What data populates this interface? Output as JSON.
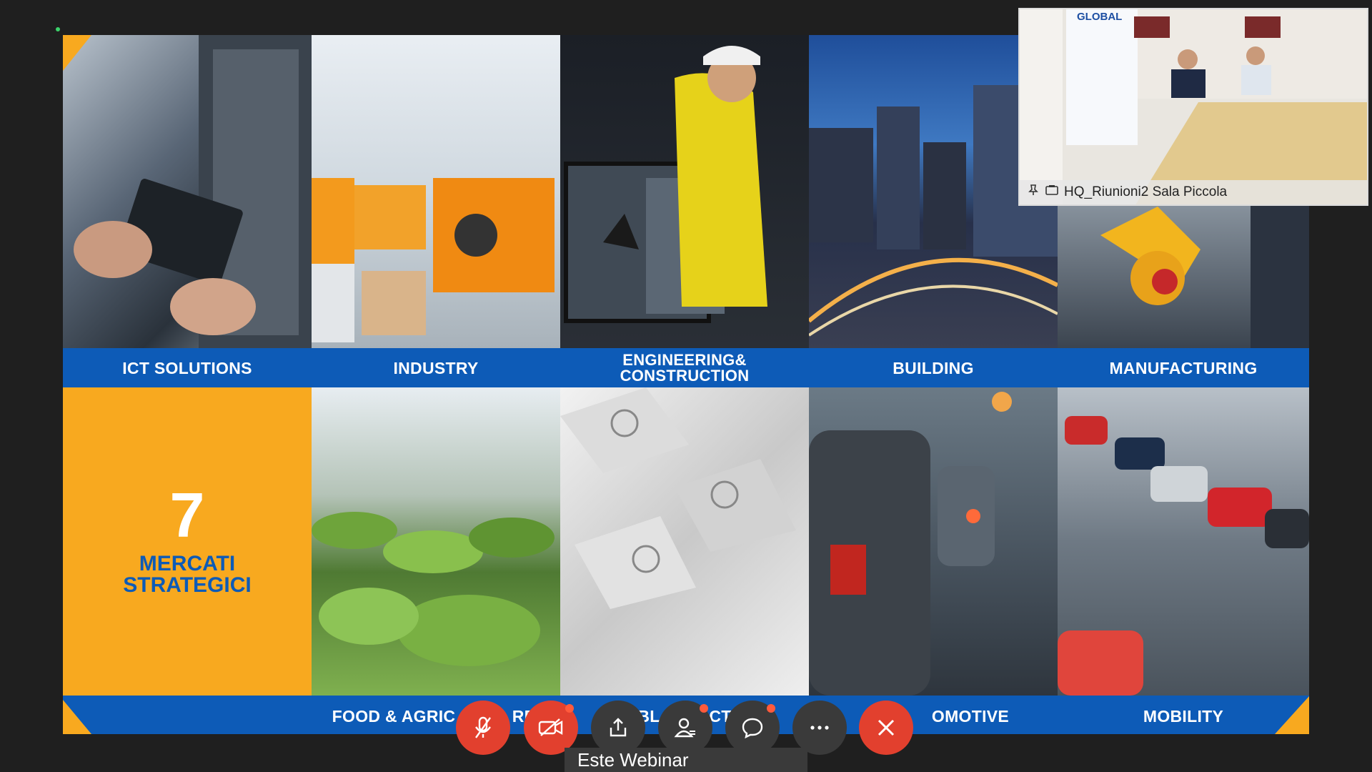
{
  "meeting": {
    "thumbnail_label": "HQ_Riunioni2 Sala Piccola",
    "thumbnail_banner_text": "GLOBAL",
    "webinar_title": "Este Webinar"
  },
  "slide": {
    "top_labels": [
      "ICT SOLUTIONS",
      "INDUSTRY",
      "ENGINEERING&",
      "CONSTRUCTION",
      "BUILDING",
      "MANUFACTURING"
    ],
    "bottom_labels": [
      "FOOD & AGRIC",
      "RE",
      "BL",
      "CT",
      "OMOTIVE",
      "MOBILITY"
    ],
    "big_number": "7",
    "headline_line1": "MERCATI",
    "headline_line2": "STRATEGICI"
  },
  "controls": [
    {
      "name": "mute-mic-button",
      "icon": "mic-off-icon",
      "color": "#e2402e"
    },
    {
      "name": "stop-video-button",
      "icon": "video-off-icon",
      "color": "#e2402e"
    },
    {
      "name": "share-button",
      "icon": "share-icon",
      "color": "#3a3a3a"
    },
    {
      "name": "participants-button",
      "icon": "participants-icon",
      "color": "#3a3a3a"
    },
    {
      "name": "chat-button",
      "icon": "chat-icon",
      "color": "#3a3a3a"
    },
    {
      "name": "more-options-button",
      "icon": "more-icon",
      "color": "#3a3a3a"
    },
    {
      "name": "leave-meeting-button",
      "icon": "close-icon",
      "color": "#e2402e"
    }
  ],
  "colors": {
    "brand_blue": "#0d5bb7",
    "brand_yellow": "#f8a91f",
    "control_red": "#e2402e",
    "control_dark": "#3a3a3a"
  }
}
